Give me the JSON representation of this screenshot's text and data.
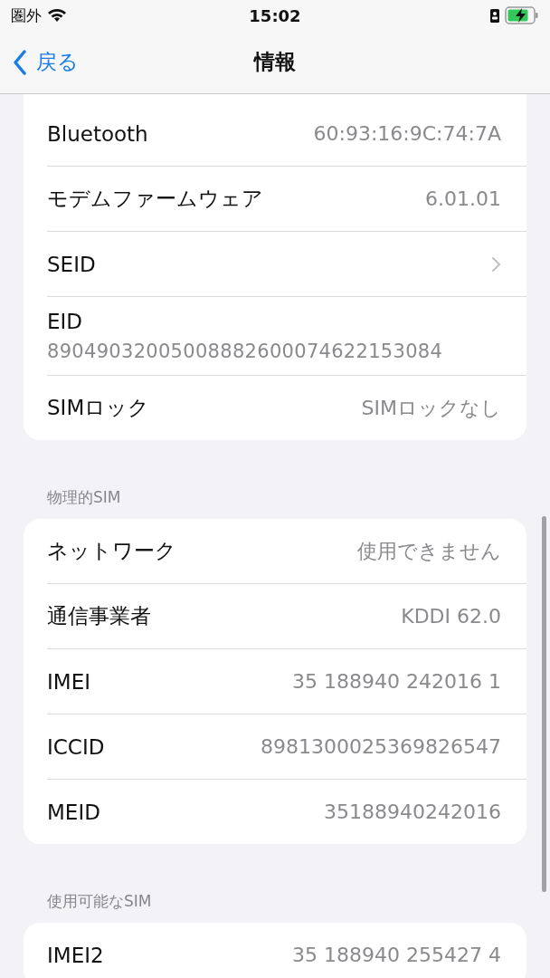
{
  "status_bar": {
    "carrier": "圏外",
    "time": "15:02"
  },
  "nav": {
    "back": "戻る",
    "title": "情報"
  },
  "sections": [
    {
      "rows": [
        {
          "kind": "value",
          "label": "Bluetooth",
          "value": "60:93:16:9C:74:7A"
        },
        {
          "kind": "value",
          "label": "モデムファームウェア",
          "value": "6.01.01"
        },
        {
          "kind": "link",
          "label": "SEID"
        },
        {
          "kind": "stacked",
          "label": "EID",
          "value": "89049032005008882600074622153084"
        },
        {
          "kind": "value",
          "label": "SIMロック",
          "value": "SIMロックなし"
        }
      ]
    },
    {
      "header": "物理的SIM",
      "rows": [
        {
          "kind": "value",
          "label": "ネットワーク",
          "value": "使用できません"
        },
        {
          "kind": "value",
          "label": "通信事業者",
          "value": "KDDI 62.0"
        },
        {
          "kind": "value",
          "label": "IMEI",
          "value": "35 188940 242016 1"
        },
        {
          "kind": "value",
          "label": "ICCID",
          "value": "8981300025369826547"
        },
        {
          "kind": "value",
          "label": "MEID",
          "value": "35188940242016"
        }
      ]
    },
    {
      "header": "使用可能なSIM",
      "rows": [
        {
          "kind": "value",
          "label": "IMEI2",
          "value": "35 188940 255427 4"
        }
      ]
    }
  ]
}
